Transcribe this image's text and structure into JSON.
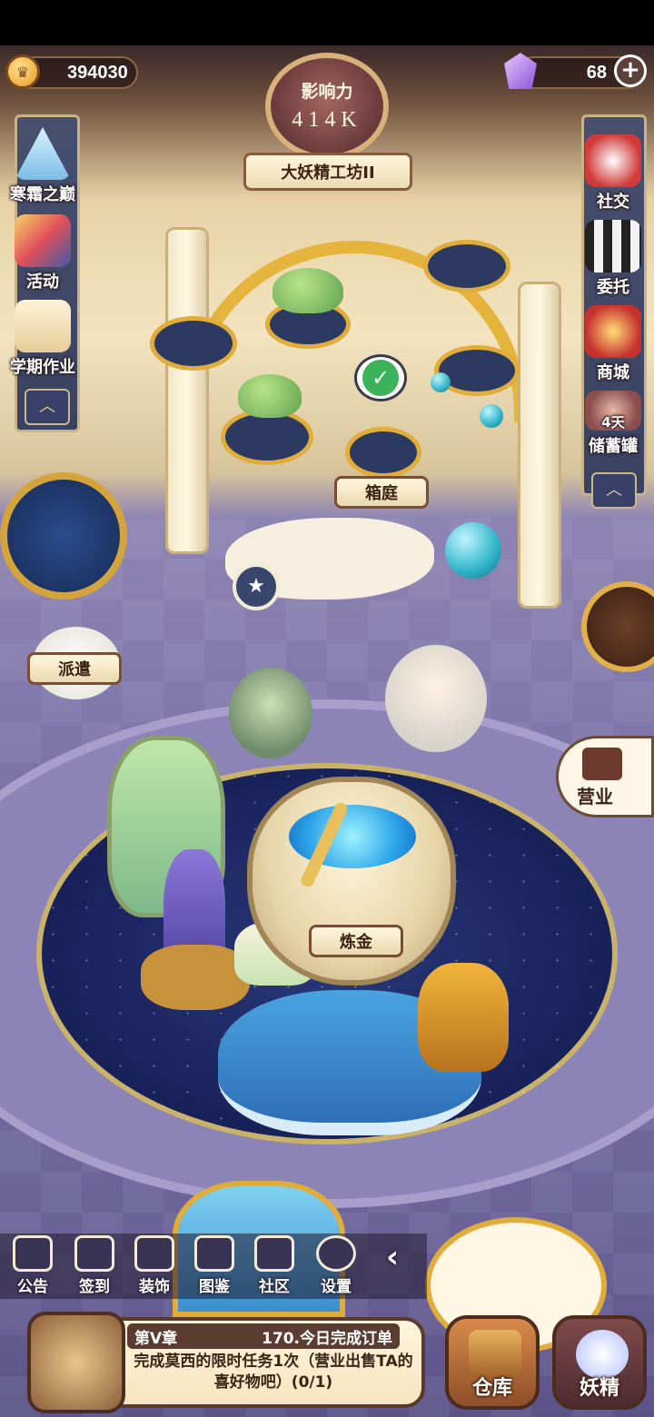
{
  "currency": {
    "coins": "394030",
    "gems": "68"
  },
  "influence": {
    "label": "影响力",
    "value": "414K"
  },
  "shop_name": "大妖精工坊II",
  "left_menu": [
    {
      "label": "寒霜之巅",
      "icon": "ice-mountain-icon"
    },
    {
      "label": "活动",
      "icon": "event-picture-icon"
    },
    {
      "label": "学期作业",
      "icon": "homework-scroll-icon"
    }
  ],
  "right_menu": [
    {
      "label": "社交",
      "icon": "social-icon"
    },
    {
      "label": "委托",
      "icon": "commission-icon"
    },
    {
      "label": "商城",
      "icon": "mall-icon"
    },
    {
      "label": "储蓄罐",
      "icon": "piggy-bank-icon",
      "badge": "4天"
    }
  ],
  "stations": {
    "garden": "箱庭",
    "dispatch": "派遣",
    "alchemy": "炼金",
    "business": "营业"
  },
  "bottom_menu": [
    {
      "label": "公告",
      "icon": "notice-icon"
    },
    {
      "label": "签到",
      "icon": "checkin-icon"
    },
    {
      "label": "装饰",
      "icon": "decoration-icon"
    },
    {
      "label": "图鉴",
      "icon": "handbook-icon"
    },
    {
      "label": "社区",
      "icon": "community-icon"
    },
    {
      "label": "设置",
      "icon": "settings-icon"
    }
  ],
  "quest": {
    "chapter": "第V章",
    "progress_title": "170.今日完成订单",
    "description": "完成莫西的限时任务1次（营业出售TA的喜好物吧）(0/1)"
  },
  "bottom_buttons": {
    "warehouse": "仓库",
    "fairy": "妖精"
  },
  "colors": {
    "frame_gold": "#e0ac3a",
    "panel_dark": "#5b3c30",
    "floor_purple": "#7c74a8",
    "check_green": "#3cb25a"
  }
}
